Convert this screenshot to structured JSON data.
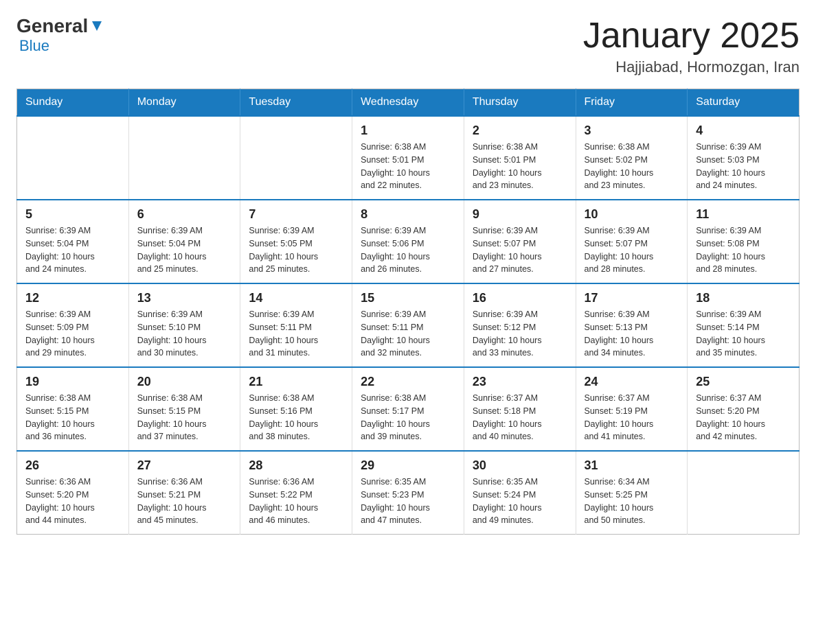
{
  "logo": {
    "general": "General",
    "blue": "Blue"
  },
  "title": "January 2025",
  "subtitle": "Hajjiabad, Hormozgan, Iran",
  "days_of_week": [
    "Sunday",
    "Monday",
    "Tuesday",
    "Wednesday",
    "Thursday",
    "Friday",
    "Saturday"
  ],
  "weeks": [
    [
      {
        "day": "",
        "info": ""
      },
      {
        "day": "",
        "info": ""
      },
      {
        "day": "",
        "info": ""
      },
      {
        "day": "1",
        "info": "Sunrise: 6:38 AM\nSunset: 5:01 PM\nDaylight: 10 hours\nand 22 minutes."
      },
      {
        "day": "2",
        "info": "Sunrise: 6:38 AM\nSunset: 5:01 PM\nDaylight: 10 hours\nand 23 minutes."
      },
      {
        "day": "3",
        "info": "Sunrise: 6:38 AM\nSunset: 5:02 PM\nDaylight: 10 hours\nand 23 minutes."
      },
      {
        "day": "4",
        "info": "Sunrise: 6:39 AM\nSunset: 5:03 PM\nDaylight: 10 hours\nand 24 minutes."
      }
    ],
    [
      {
        "day": "5",
        "info": "Sunrise: 6:39 AM\nSunset: 5:04 PM\nDaylight: 10 hours\nand 24 minutes."
      },
      {
        "day": "6",
        "info": "Sunrise: 6:39 AM\nSunset: 5:04 PM\nDaylight: 10 hours\nand 25 minutes."
      },
      {
        "day": "7",
        "info": "Sunrise: 6:39 AM\nSunset: 5:05 PM\nDaylight: 10 hours\nand 25 minutes."
      },
      {
        "day": "8",
        "info": "Sunrise: 6:39 AM\nSunset: 5:06 PM\nDaylight: 10 hours\nand 26 minutes."
      },
      {
        "day": "9",
        "info": "Sunrise: 6:39 AM\nSunset: 5:07 PM\nDaylight: 10 hours\nand 27 minutes."
      },
      {
        "day": "10",
        "info": "Sunrise: 6:39 AM\nSunset: 5:07 PM\nDaylight: 10 hours\nand 28 minutes."
      },
      {
        "day": "11",
        "info": "Sunrise: 6:39 AM\nSunset: 5:08 PM\nDaylight: 10 hours\nand 28 minutes."
      }
    ],
    [
      {
        "day": "12",
        "info": "Sunrise: 6:39 AM\nSunset: 5:09 PM\nDaylight: 10 hours\nand 29 minutes."
      },
      {
        "day": "13",
        "info": "Sunrise: 6:39 AM\nSunset: 5:10 PM\nDaylight: 10 hours\nand 30 minutes."
      },
      {
        "day": "14",
        "info": "Sunrise: 6:39 AM\nSunset: 5:11 PM\nDaylight: 10 hours\nand 31 minutes."
      },
      {
        "day": "15",
        "info": "Sunrise: 6:39 AM\nSunset: 5:11 PM\nDaylight: 10 hours\nand 32 minutes."
      },
      {
        "day": "16",
        "info": "Sunrise: 6:39 AM\nSunset: 5:12 PM\nDaylight: 10 hours\nand 33 minutes."
      },
      {
        "day": "17",
        "info": "Sunrise: 6:39 AM\nSunset: 5:13 PM\nDaylight: 10 hours\nand 34 minutes."
      },
      {
        "day": "18",
        "info": "Sunrise: 6:39 AM\nSunset: 5:14 PM\nDaylight: 10 hours\nand 35 minutes."
      }
    ],
    [
      {
        "day": "19",
        "info": "Sunrise: 6:38 AM\nSunset: 5:15 PM\nDaylight: 10 hours\nand 36 minutes."
      },
      {
        "day": "20",
        "info": "Sunrise: 6:38 AM\nSunset: 5:15 PM\nDaylight: 10 hours\nand 37 minutes."
      },
      {
        "day": "21",
        "info": "Sunrise: 6:38 AM\nSunset: 5:16 PM\nDaylight: 10 hours\nand 38 minutes."
      },
      {
        "day": "22",
        "info": "Sunrise: 6:38 AM\nSunset: 5:17 PM\nDaylight: 10 hours\nand 39 minutes."
      },
      {
        "day": "23",
        "info": "Sunrise: 6:37 AM\nSunset: 5:18 PM\nDaylight: 10 hours\nand 40 minutes."
      },
      {
        "day": "24",
        "info": "Sunrise: 6:37 AM\nSunset: 5:19 PM\nDaylight: 10 hours\nand 41 minutes."
      },
      {
        "day": "25",
        "info": "Sunrise: 6:37 AM\nSunset: 5:20 PM\nDaylight: 10 hours\nand 42 minutes."
      }
    ],
    [
      {
        "day": "26",
        "info": "Sunrise: 6:36 AM\nSunset: 5:20 PM\nDaylight: 10 hours\nand 44 minutes."
      },
      {
        "day": "27",
        "info": "Sunrise: 6:36 AM\nSunset: 5:21 PM\nDaylight: 10 hours\nand 45 minutes."
      },
      {
        "day": "28",
        "info": "Sunrise: 6:36 AM\nSunset: 5:22 PM\nDaylight: 10 hours\nand 46 minutes."
      },
      {
        "day": "29",
        "info": "Sunrise: 6:35 AM\nSunset: 5:23 PM\nDaylight: 10 hours\nand 47 minutes."
      },
      {
        "day": "30",
        "info": "Sunrise: 6:35 AM\nSunset: 5:24 PM\nDaylight: 10 hours\nand 49 minutes."
      },
      {
        "day": "31",
        "info": "Sunrise: 6:34 AM\nSunset: 5:25 PM\nDaylight: 10 hours\nand 50 minutes."
      },
      {
        "day": "",
        "info": ""
      }
    ]
  ]
}
